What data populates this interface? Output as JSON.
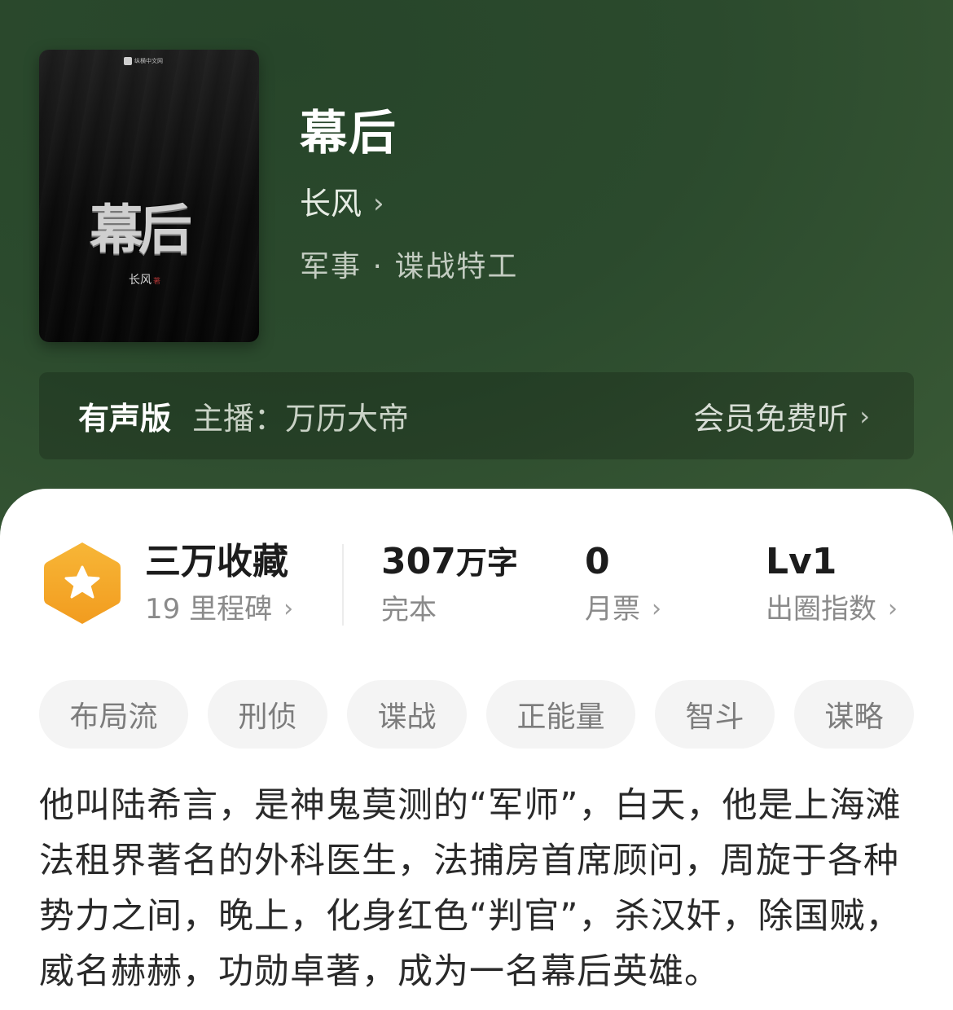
{
  "book": {
    "title": "幕后",
    "author": "长风",
    "genre": "军事 · 谍战特工",
    "cover": {
      "title": "幕后",
      "author": "长风",
      "author_tag": "著",
      "publisher": "纵横中文网"
    }
  },
  "audio": {
    "label": "有声版",
    "narrator": "主播：万历大帝",
    "listen": "会员免费听"
  },
  "stats": {
    "collect": {
      "value": "三万收藏",
      "sub": "19 里程碑"
    },
    "words": {
      "value": "307",
      "unit": "万字",
      "sub": "完本"
    },
    "tickets": {
      "value": "0",
      "sub": "月票"
    },
    "level": {
      "value": "Lv1",
      "sub": "出圈指数"
    }
  },
  "tags": [
    "布局流",
    "刑侦",
    "谍战",
    "正能量",
    "智斗",
    "谋略"
  ],
  "description": "他叫陆希言，是神鬼莫测的“军师”，白天，他是上海滩法租界著名的外科医生，法捕房首席顾问，周旋于各种势力之间，晚上，化身红色“判官”，杀汉奸，除国贼，威名赫赫，功勋卓著，成为一名幕后英雄。",
  "icons": {
    "chevron": "chevron-right-icon",
    "badge": "star-hexagon-icon"
  },
  "colors": {
    "hero_bg": "#2d4a2b",
    "badge_orange": "#f5a623",
    "tag_bg": "#f4f4f4"
  }
}
